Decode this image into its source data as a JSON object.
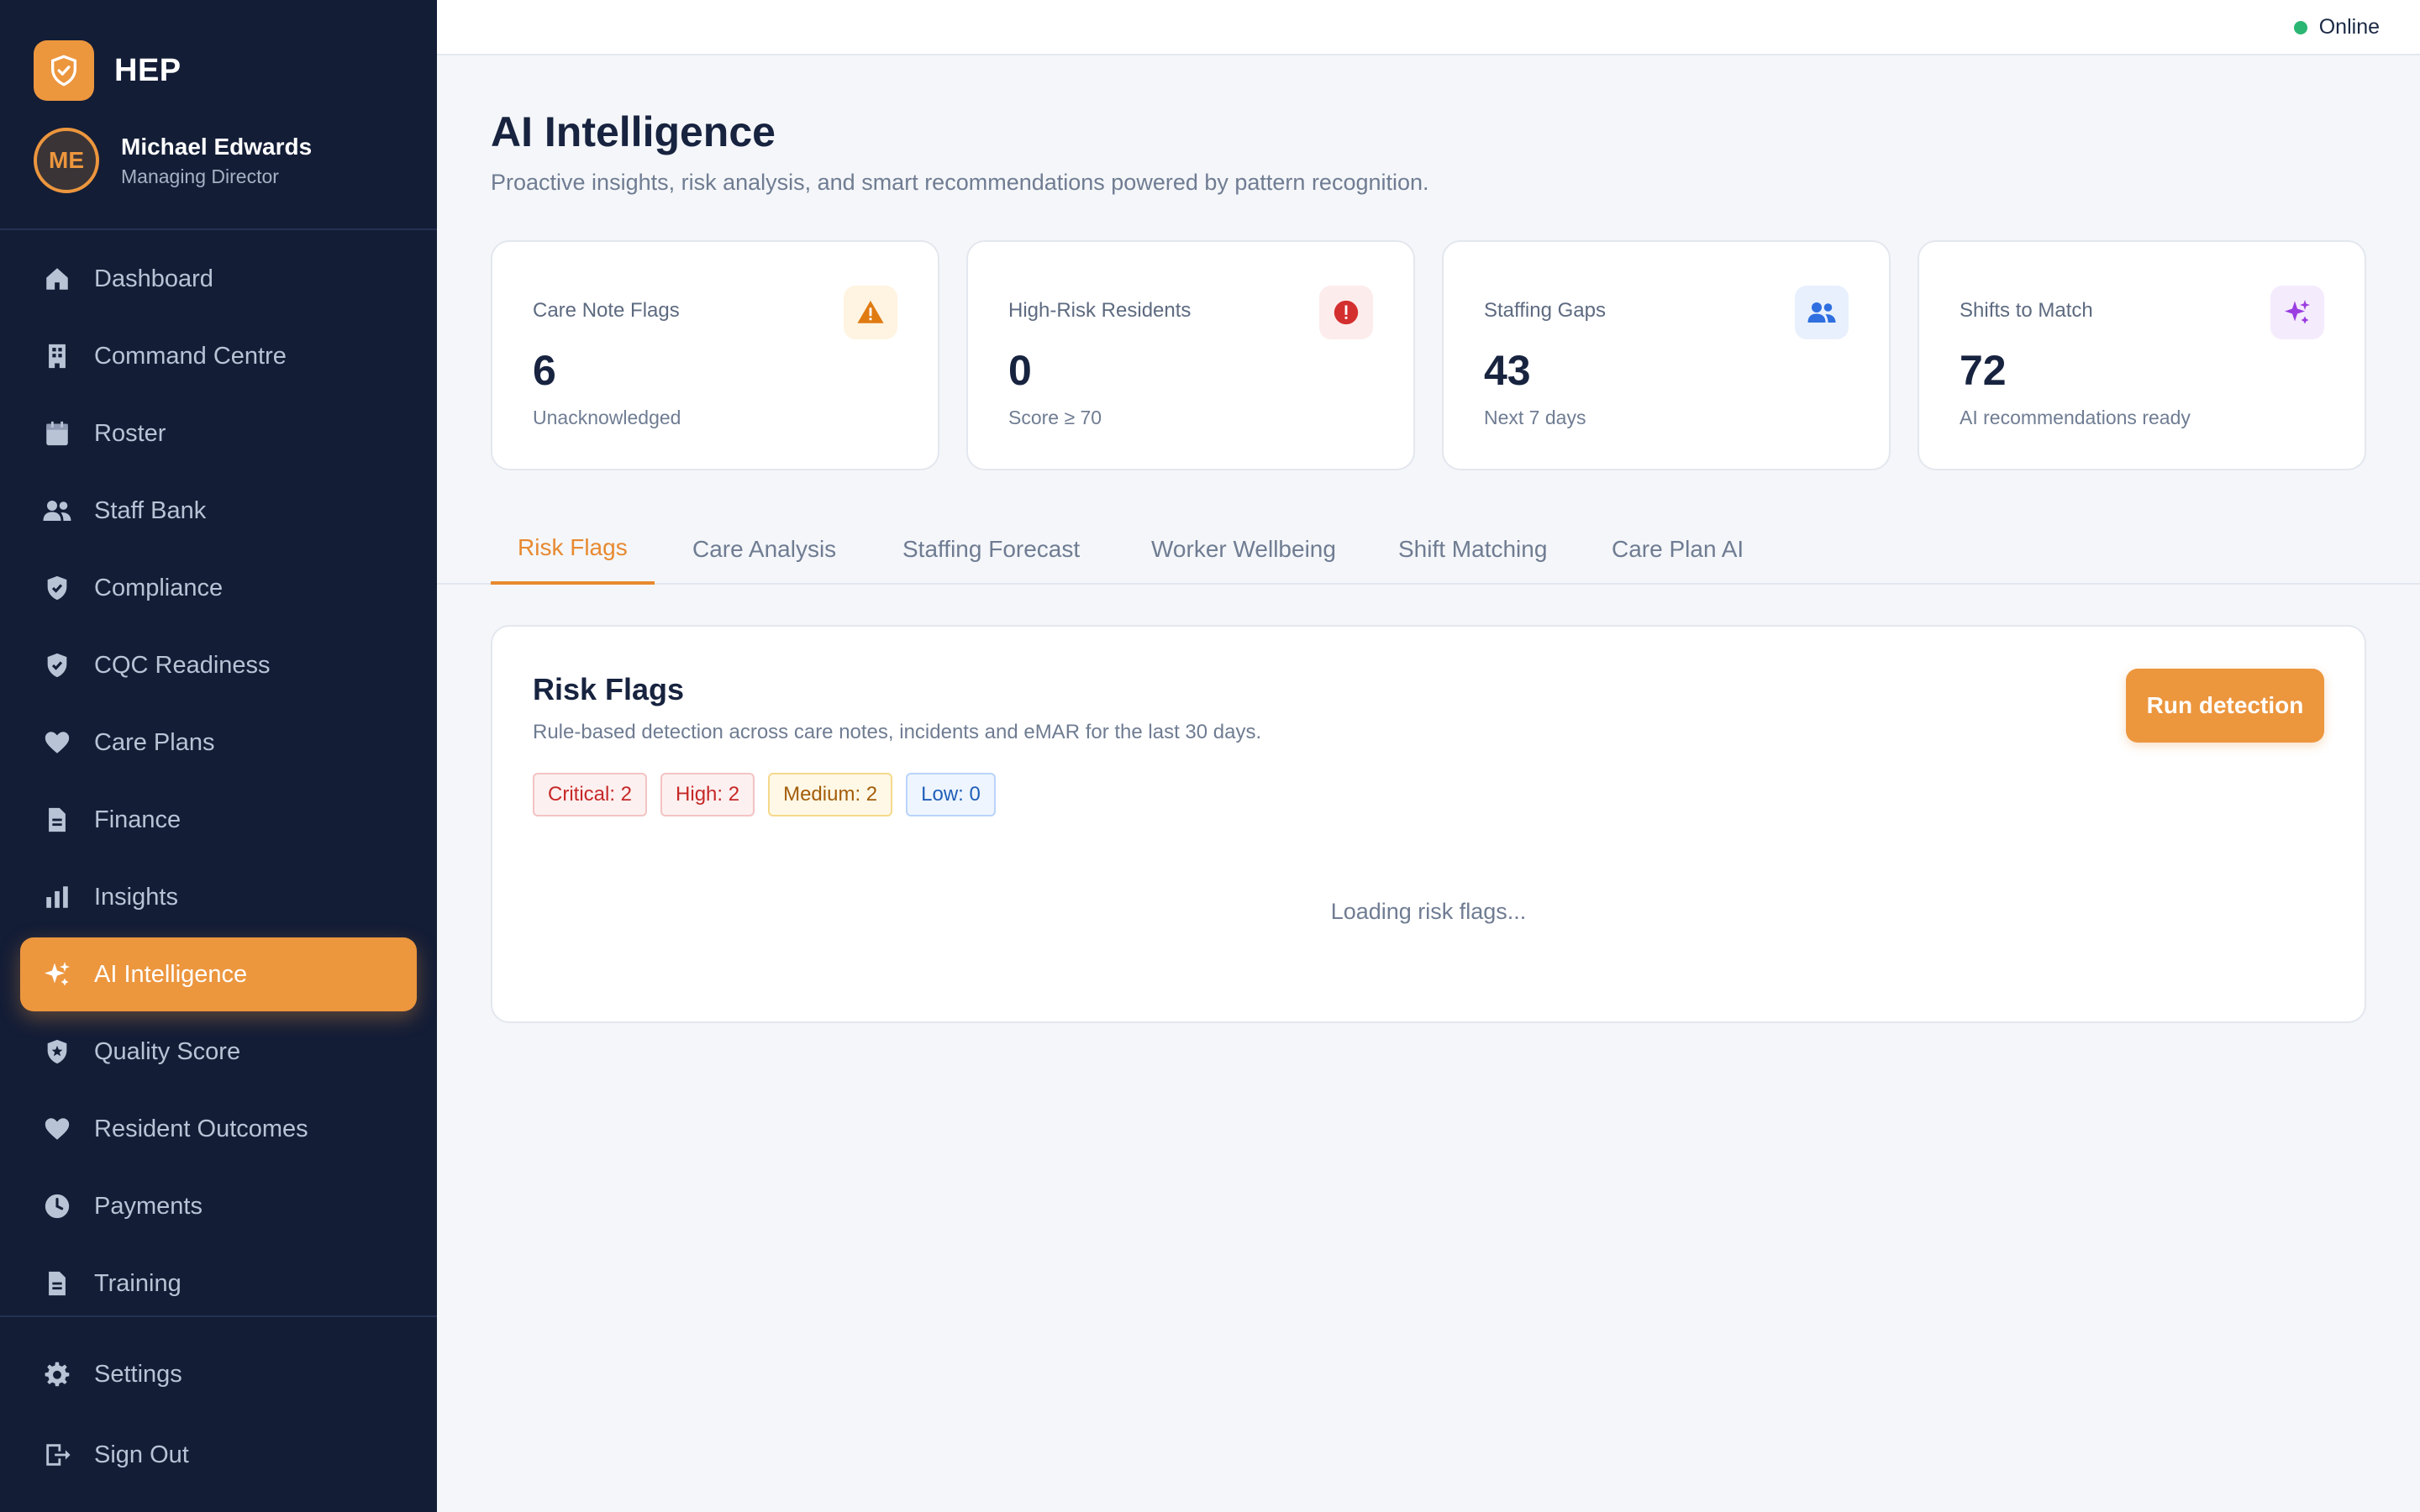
{
  "brand": {
    "name": "HEP",
    "logo_icon": "shield-check-icon",
    "accent": "#ec963e"
  },
  "user": {
    "initials": "ME",
    "name": "Michael Edwards",
    "role": "Managing Director"
  },
  "nav": {
    "items": [
      {
        "label": "Dashboard",
        "icon": "home-icon"
      },
      {
        "label": "Command Centre",
        "icon": "building-icon"
      },
      {
        "label": "Roster",
        "icon": "calendar-icon"
      },
      {
        "label": "Staff Bank",
        "icon": "people-icon"
      },
      {
        "label": "Compliance",
        "icon": "shield-check-icon"
      },
      {
        "label": "CQC Readiness",
        "icon": "shield-check-icon"
      },
      {
        "label": "Care Plans",
        "icon": "heart-icon"
      },
      {
        "label": "Finance",
        "icon": "document-icon"
      },
      {
        "label": "Insights",
        "icon": "bar-chart-icon"
      },
      {
        "label": "AI Intelligence",
        "icon": "sparkles-icon",
        "active": true
      },
      {
        "label": "Quality Score",
        "icon": "shield-star-icon"
      },
      {
        "label": "Resident Outcomes",
        "icon": "heart-icon"
      },
      {
        "label": "Payments",
        "icon": "clock-icon"
      },
      {
        "label": "Training",
        "icon": "document-icon"
      }
    ],
    "bottom": [
      {
        "label": "Settings",
        "icon": "gear-icon"
      },
      {
        "label": "Sign Out",
        "icon": "sign-out-icon"
      }
    ]
  },
  "topbar": {
    "status": "Online",
    "status_color": "#2bb673"
  },
  "page": {
    "title": "AI Intelligence",
    "subtitle": "Proactive insights, risk analysis, and smart recommendations powered by pattern recognition."
  },
  "stats": [
    {
      "label": "Care Note Flags",
      "value": "6",
      "note": "Unacknowledged",
      "icon": "warning-icon",
      "color": "#e07b12"
    },
    {
      "label": "High-Risk Residents",
      "value": "0",
      "note": "Score ≥ 70",
      "icon": "alert-circle-icon",
      "color": "#d32f2f"
    },
    {
      "label": "Staffing Gaps",
      "value": "43",
      "note": "Next 7 days",
      "icon": "people-icon",
      "color": "#2f6fe0"
    },
    {
      "label": "Shifts to Match",
      "value": "72",
      "note": "AI recommendations ready",
      "icon": "sparkles-icon",
      "color": "#9b3de0"
    }
  ],
  "tabs": [
    {
      "label": "Risk Flags",
      "active": true
    },
    {
      "label": "Care Analysis"
    },
    {
      "label": "Staffing Forecast"
    },
    {
      "label": "Worker Wellbeing"
    },
    {
      "label": "Shift Matching"
    },
    {
      "label": "Care Plan AI"
    }
  ],
  "risk_panel": {
    "title": "Risk Flags",
    "subtitle": "Rule-based detection across care notes, incidents and eMAR for the last 30 days.",
    "run_button": "Run detection",
    "badges": {
      "critical": "Critical: 2",
      "high": "High: 2",
      "medium": "Medium: 2",
      "low": "Low: 0"
    },
    "loading": "Loading risk flags..."
  }
}
